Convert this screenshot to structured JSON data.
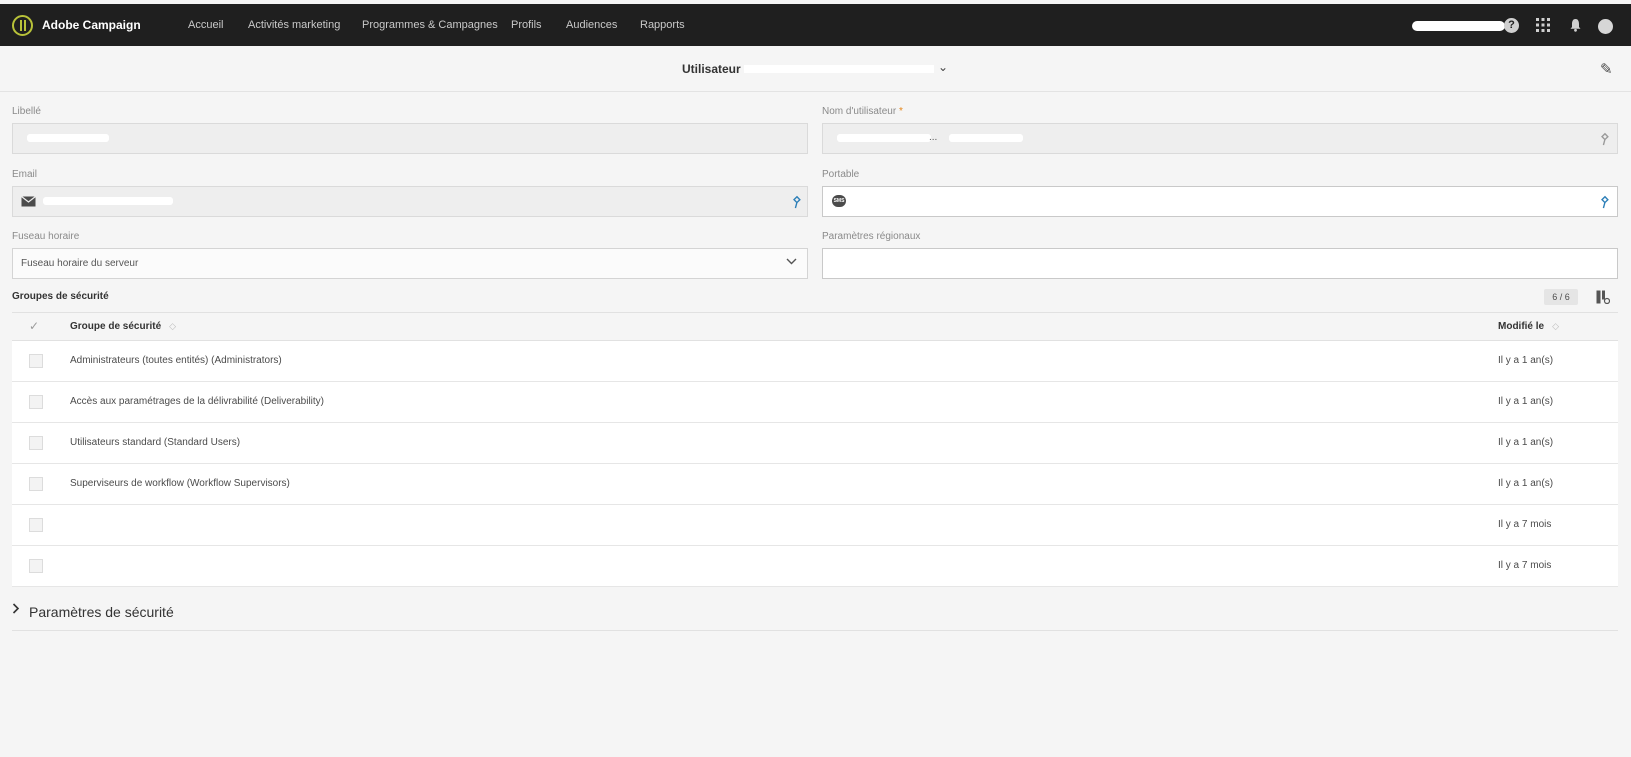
{
  "topbar": {
    "app_title": "Adobe Campaign",
    "nav": [
      "Accueil",
      "Activités marketing",
      "Programmes & Campagnes",
      "Profils",
      "Audiences",
      "Rapports"
    ],
    "help_glyph": "?",
    "icons": [
      "help-icon",
      "apps-grid-icon",
      "bell-icon",
      "avatar"
    ]
  },
  "header": {
    "title": "Utilisateur",
    "chevron": "⌄",
    "edit_glyph": "✎"
  },
  "form": {
    "libelle_label": "Libellé",
    "username_label": "Nom d'utilisateur",
    "required_mark": "*",
    "username_suffix": "...",
    "email_label": "Email",
    "mobile_label": "Portable",
    "sms_text": "SMS",
    "timezone_label": "Fuseau horaire",
    "timezone_value": "Fuseau horaire du serveur",
    "locale_label": "Paramètres régionaux"
  },
  "groups": {
    "section_title": "Groupes de sécurité",
    "counter": "6 / 6",
    "columns": {
      "group": "Groupe de sécurité",
      "modified": "Modifié le"
    },
    "rows": [
      {
        "group": "Administrateurs (toutes entités) (Administrators)",
        "modified": "Il y a 1 an(s)"
      },
      {
        "group": "Accès aux paramétrages de la délivrabilité (Deliverability)",
        "modified": "Il y a 1 an(s)"
      },
      {
        "group": "Utilisateurs standard (Standard Users)",
        "modified": "Il y a 1 an(s)"
      },
      {
        "group": "Superviseurs de workflow (Workflow Supervisors)",
        "modified": "Il y a 1 an(s)"
      },
      {
        "group": "",
        "modified": "Il y a 7 mois"
      },
      {
        "group": "",
        "modified": "Il y a 7 mois"
      }
    ]
  },
  "security_section": {
    "title": "Paramètres de sécurité",
    "chevron": "›"
  },
  "colors": {
    "topbar_bg": "#1f1f1f",
    "logo_accent": "#b8c239",
    "pin_accent": "#2c7fb8",
    "required_accent": "#e68619"
  }
}
